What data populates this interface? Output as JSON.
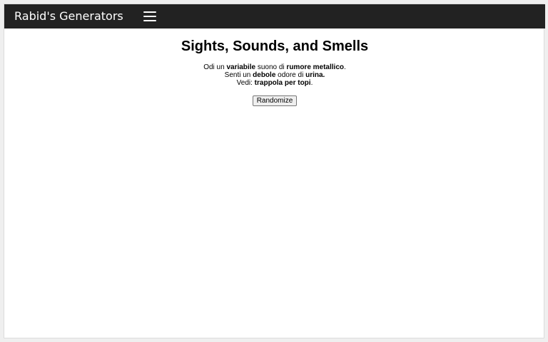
{
  "navbar": {
    "brand": "Rabid's Generators",
    "menu_icon": "hamburger-menu-icon"
  },
  "page": {
    "title": "Sights, Sounds, and Smells"
  },
  "result": {
    "sound": {
      "prefix": "Odi un ",
      "adjective": "variabile",
      "middle": " suono di ",
      "noun": "rumore metallico",
      "suffix": "."
    },
    "smell": {
      "prefix": "Senti un ",
      "adjective": "debole",
      "middle": " odore di ",
      "noun": "urina.",
      "suffix": ""
    },
    "sight": {
      "prefix": "Vedi: ",
      "noun": "trappola per topi",
      "suffix": "."
    }
  },
  "controls": {
    "randomize_label": "Randomize"
  },
  "colors": {
    "navbar_bg": "#222222",
    "page_bg": "#ffffff"
  }
}
